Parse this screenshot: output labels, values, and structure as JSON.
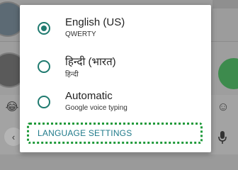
{
  "popup": {
    "options": [
      {
        "title": "English (US)",
        "subtitle": "QWERTY",
        "selected": true
      },
      {
        "title": "हिन्दी (भारत)",
        "subtitle": "हिन्दी",
        "selected": false
      },
      {
        "title": "Automatic",
        "subtitle": "Google voice typing",
        "selected": false
      }
    ],
    "settings_label": "LANGUAGE SETTINGS"
  },
  "keyboard": {
    "emoji_left": "😂",
    "emoji_right": "☺",
    "back_icon": "‹"
  },
  "colors": {
    "accent": "#1f7a6f",
    "settings_text": "#1f7a8a",
    "highlight_border": "#1f9a3a"
  },
  "icons": {
    "radio_selected": "radio-checked-icon",
    "radio_unselected": "radio-unchecked-icon",
    "mic": "mic-icon"
  }
}
